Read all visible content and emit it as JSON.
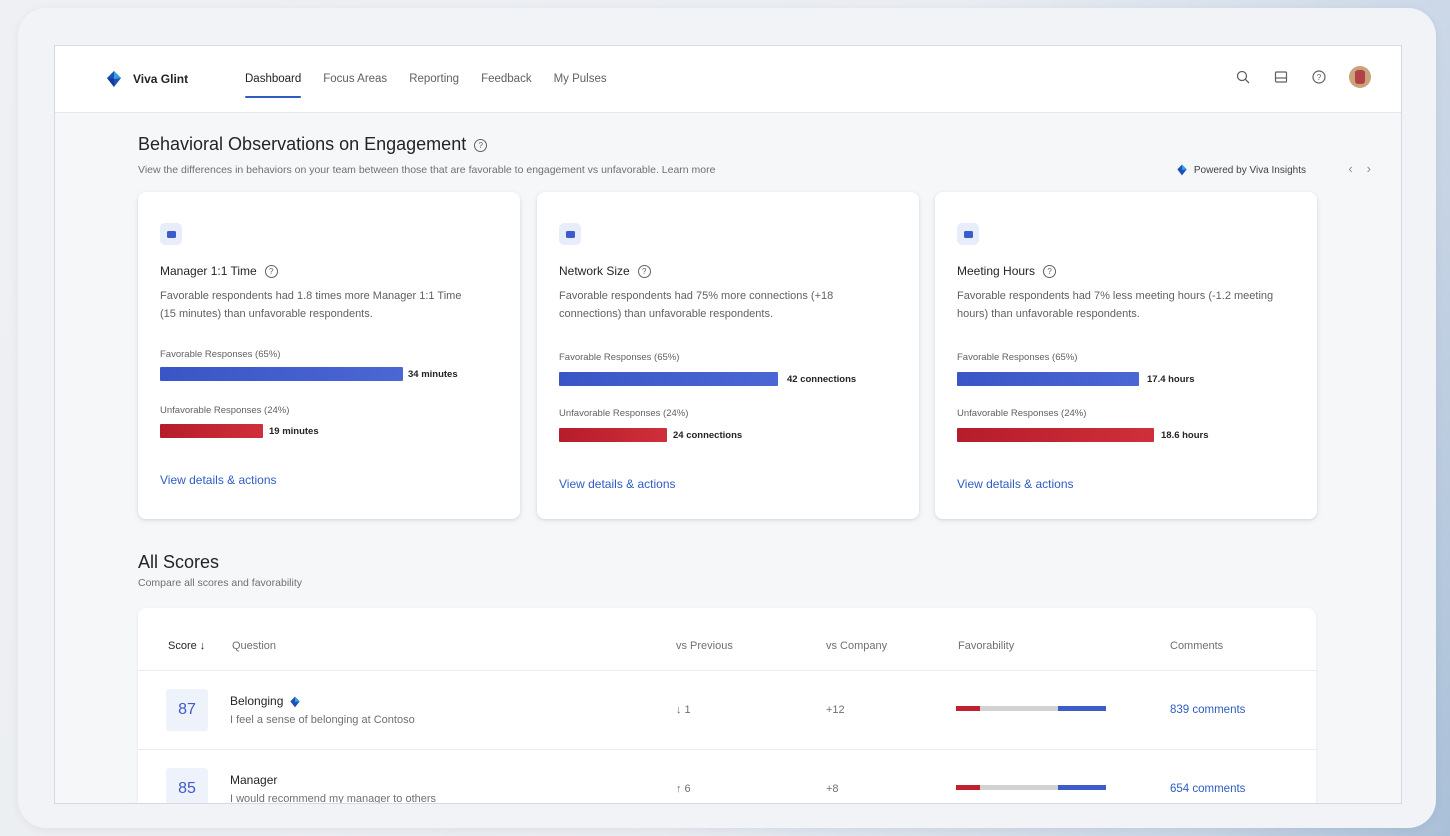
{
  "app": {
    "brand": "Viva Glint"
  },
  "nav": {
    "items": [
      {
        "label": "Dashboard",
        "active": true
      },
      {
        "label": "Focus Areas"
      },
      {
        "label": "Reporting"
      },
      {
        "label": "Feedback"
      },
      {
        "label": "My Pulses"
      }
    ]
  },
  "header_icons": [
    "search-icon",
    "inbox-icon",
    "help-icon",
    "avatar"
  ],
  "behavioral": {
    "title": "Behavioral Observations on Engagement",
    "subtitle": "View the differences in behaviors on your team between those that are favorable to engagement vs unfavorable. Learn more",
    "powered_by": "Powered by Viva Insights",
    "cards": [
      {
        "icon": "people-icon",
        "title": "Manager 1:1 Time",
        "desc": "Favorable respondents had 1.8 times more Manager 1:1 Time (15 minutes) than unfavorable respondents.",
        "fav_label": "Favorable Responses (65%)",
        "fav_value": "34 minutes",
        "fav_fraction": 1.0,
        "unf_label": "Unfavorable Responses (24%)",
        "unf_value": "19 minutes",
        "unf_fraction": 0.56,
        "link": "View details & actions"
      },
      {
        "icon": "network-icon",
        "title": "Network Size",
        "desc": "Favorable respondents had 75% more connections (+18 connections) than unfavorable respondents.",
        "fav_label": "Favorable Responses (65%)",
        "fav_value": "42 connections",
        "fav_fraction": 1.0,
        "unf_label": "Unfavorable Responses (24%)",
        "unf_value": "24 connections",
        "unf_fraction": 0.57,
        "link": "View details & actions"
      },
      {
        "icon": "calendar-icon",
        "title": "Meeting Hours",
        "desc": "Favorable respondents had 7% less meeting hours (-1.2 meeting hours) than unfavorable respondents.",
        "fav_label": "Favorable Responses (65%)",
        "fav_value": "17.4 hours",
        "fav_fraction": 0.93,
        "unf_label": "Unfavorable Responses (24%)",
        "unf_value": "18.6 hours",
        "unf_fraction": 1.0,
        "link": "View details & actions"
      }
    ]
  },
  "all_scores": {
    "title": "All Scores",
    "subtitle": "Compare all scores and favorability",
    "columns": {
      "score": "Score ↓",
      "question": "Question",
      "vs_previous": "vs Previous",
      "vs_company": "vs Company",
      "favorability": "Favorability",
      "comments": "Comments"
    },
    "rows": [
      {
        "score": "87",
        "title": "Belonging",
        "text": "I feel a sense of belonging at Contoso",
        "vs_previous": "↓ 1",
        "vs_company": "+12",
        "unfavorable_fraction": 0.16,
        "favorable_fraction": 0.32,
        "comments": "839 comments"
      },
      {
        "score": "85",
        "title": "Manager",
        "text": "I would recommend my manager to others",
        "vs_previous": "↑ 6",
        "vs_company": "+8",
        "unfavorable_fraction": 0.16,
        "favorable_fraction": 0.32,
        "comments": "654 comments"
      }
    ]
  },
  "colors": {
    "accent": "#2f5cc2",
    "favorable": "#3d5bc9",
    "unfavorable": "#c0202f"
  }
}
